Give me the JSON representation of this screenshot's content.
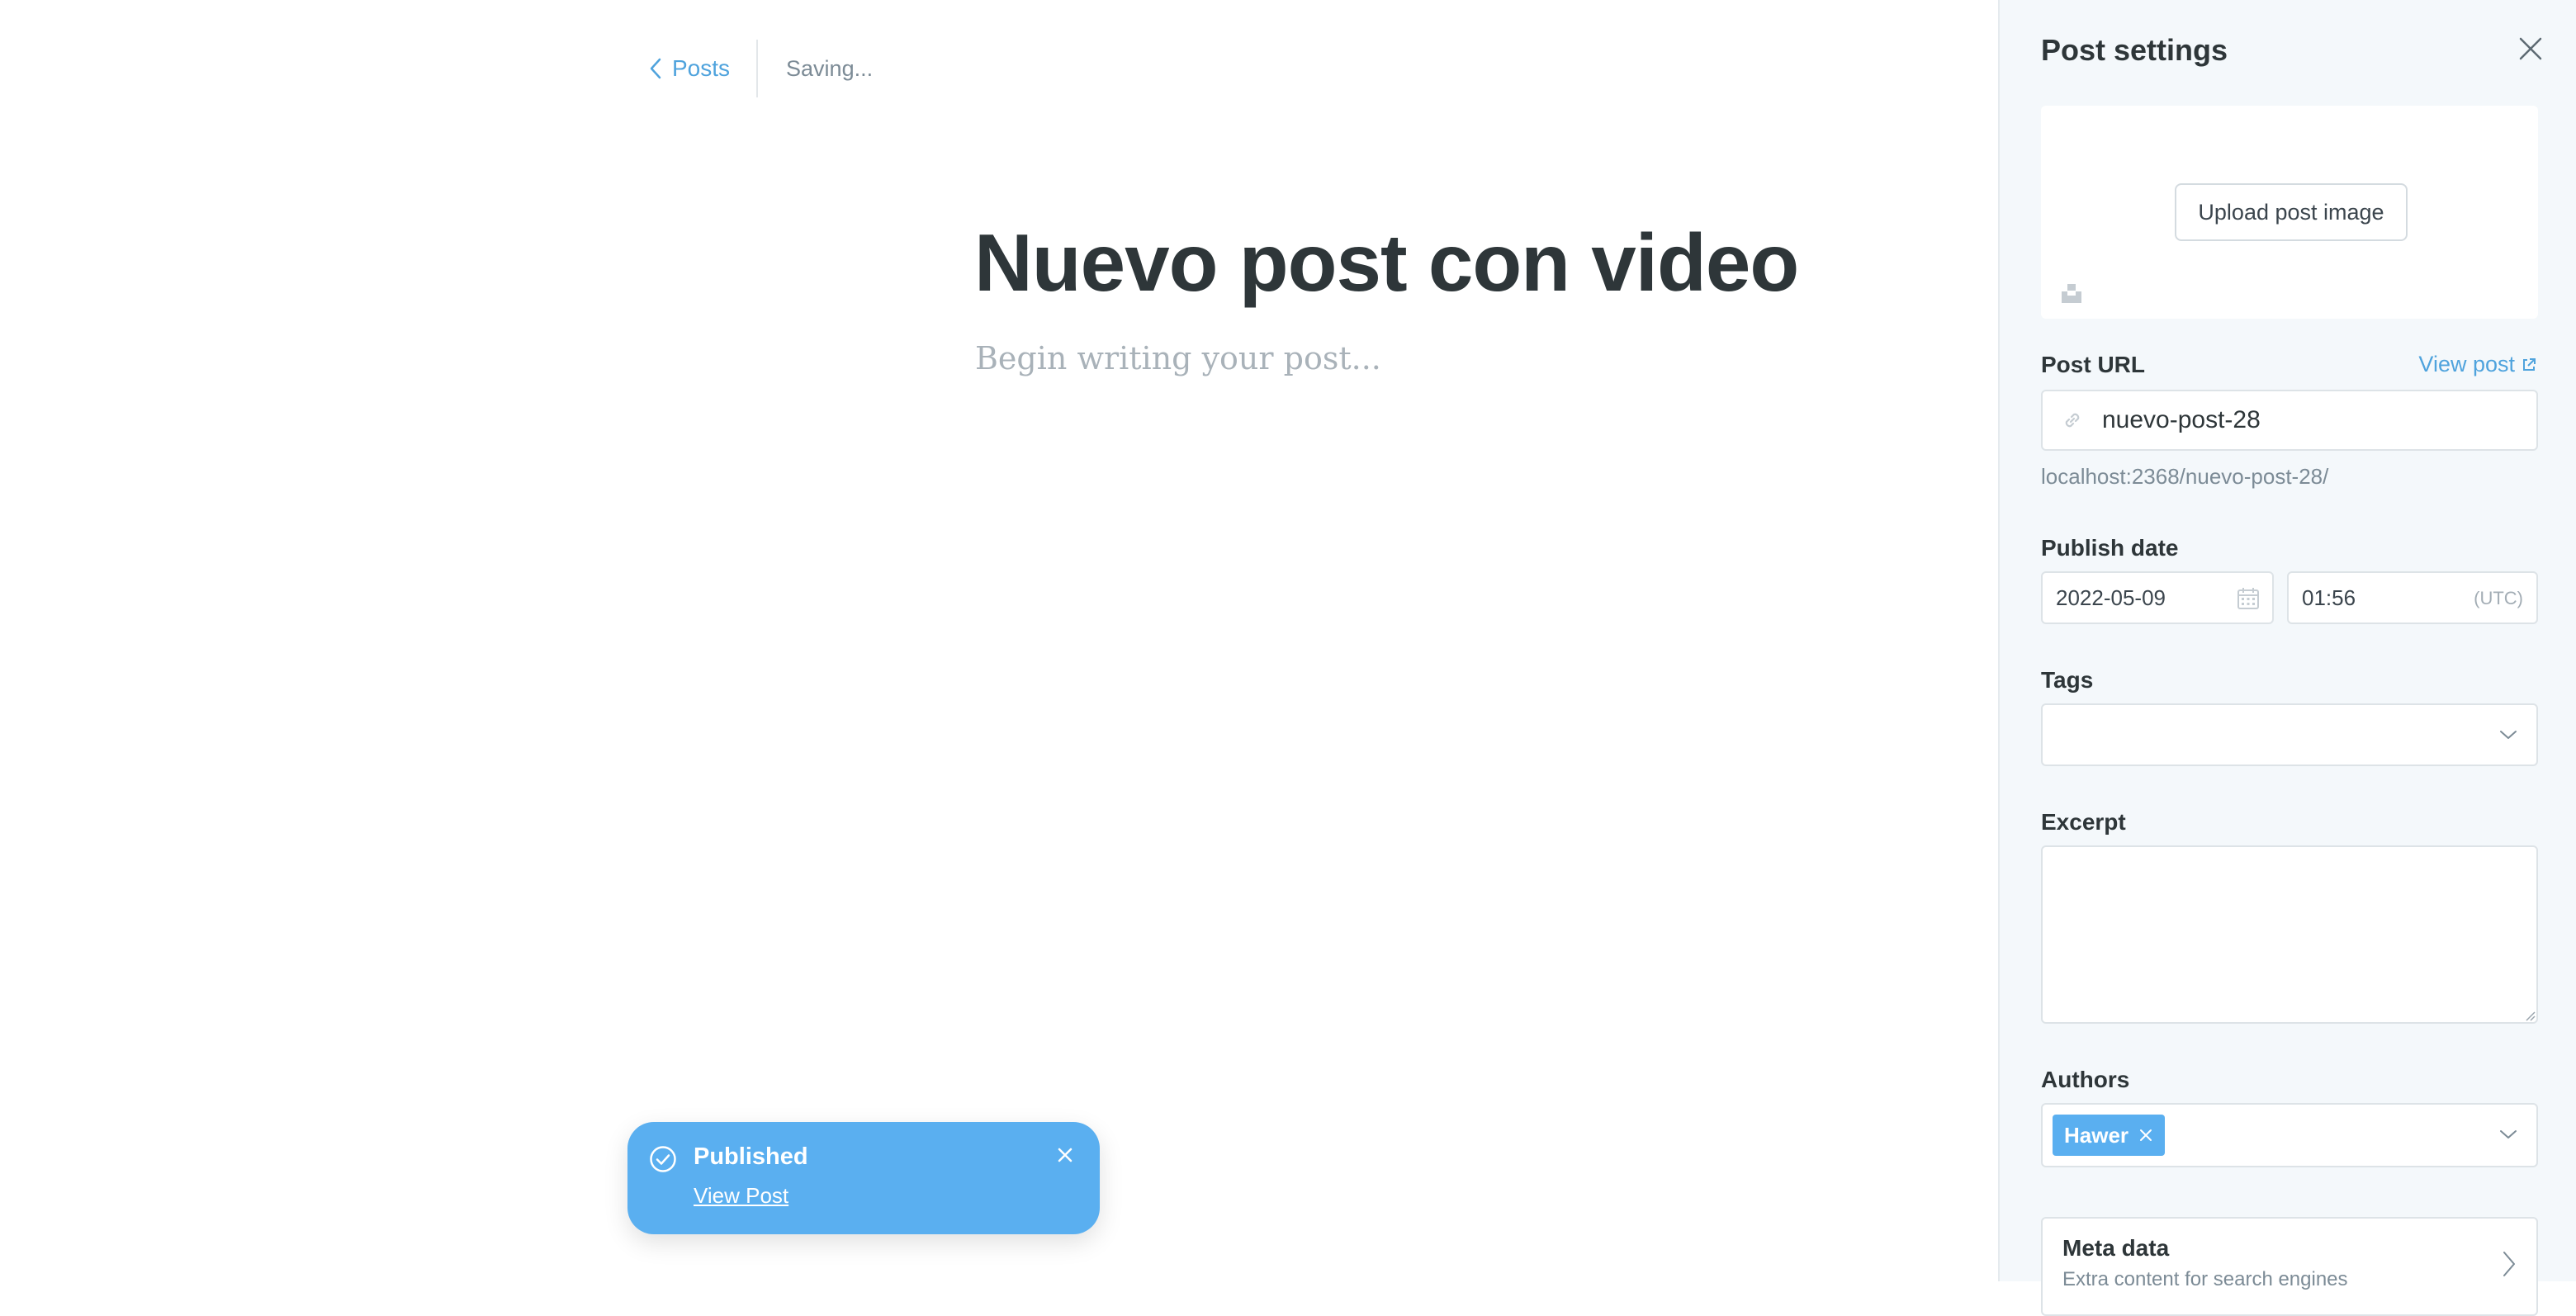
{
  "editor": {
    "back_label": "Posts",
    "status": "Saving...",
    "title": "Nuevo post con video",
    "body_placeholder": "Begin writing your post..."
  },
  "toast": {
    "title": "Published",
    "link": "View Post"
  },
  "settings": {
    "title": "Post settings",
    "upload_button": "Upload post image",
    "post_url": {
      "label": "Post URL",
      "view_link": "View post",
      "value": "nuevo-post-28",
      "help": "localhost:2368/nuevo-post-28/"
    },
    "publish_date": {
      "label": "Publish date",
      "date": "2022-05-09",
      "time": "01:56",
      "timezone": "(UTC)"
    },
    "tags": {
      "label": "Tags"
    },
    "excerpt": {
      "label": "Excerpt",
      "value": ""
    },
    "authors": {
      "label": "Authors",
      "items": [
        "Hawer"
      ]
    },
    "meta_data": {
      "title": "Meta data",
      "subtitle": "Extra content for search engines"
    }
  },
  "colors": {
    "accent": "#5aaff0",
    "link": "#4fa3dd",
    "panel_bg": "#f4f8fb",
    "title_text": "#2e3639"
  },
  "icons": {
    "back": "chevron-left-icon",
    "toast_status": "check-circle-icon",
    "close": "close-icon",
    "external": "external-link-icon",
    "url": "link-icon",
    "date": "calendar-icon",
    "dropdown": "chevron-down-icon",
    "meta": "chevron-right-icon",
    "unsplash": "unsplash-icon"
  }
}
